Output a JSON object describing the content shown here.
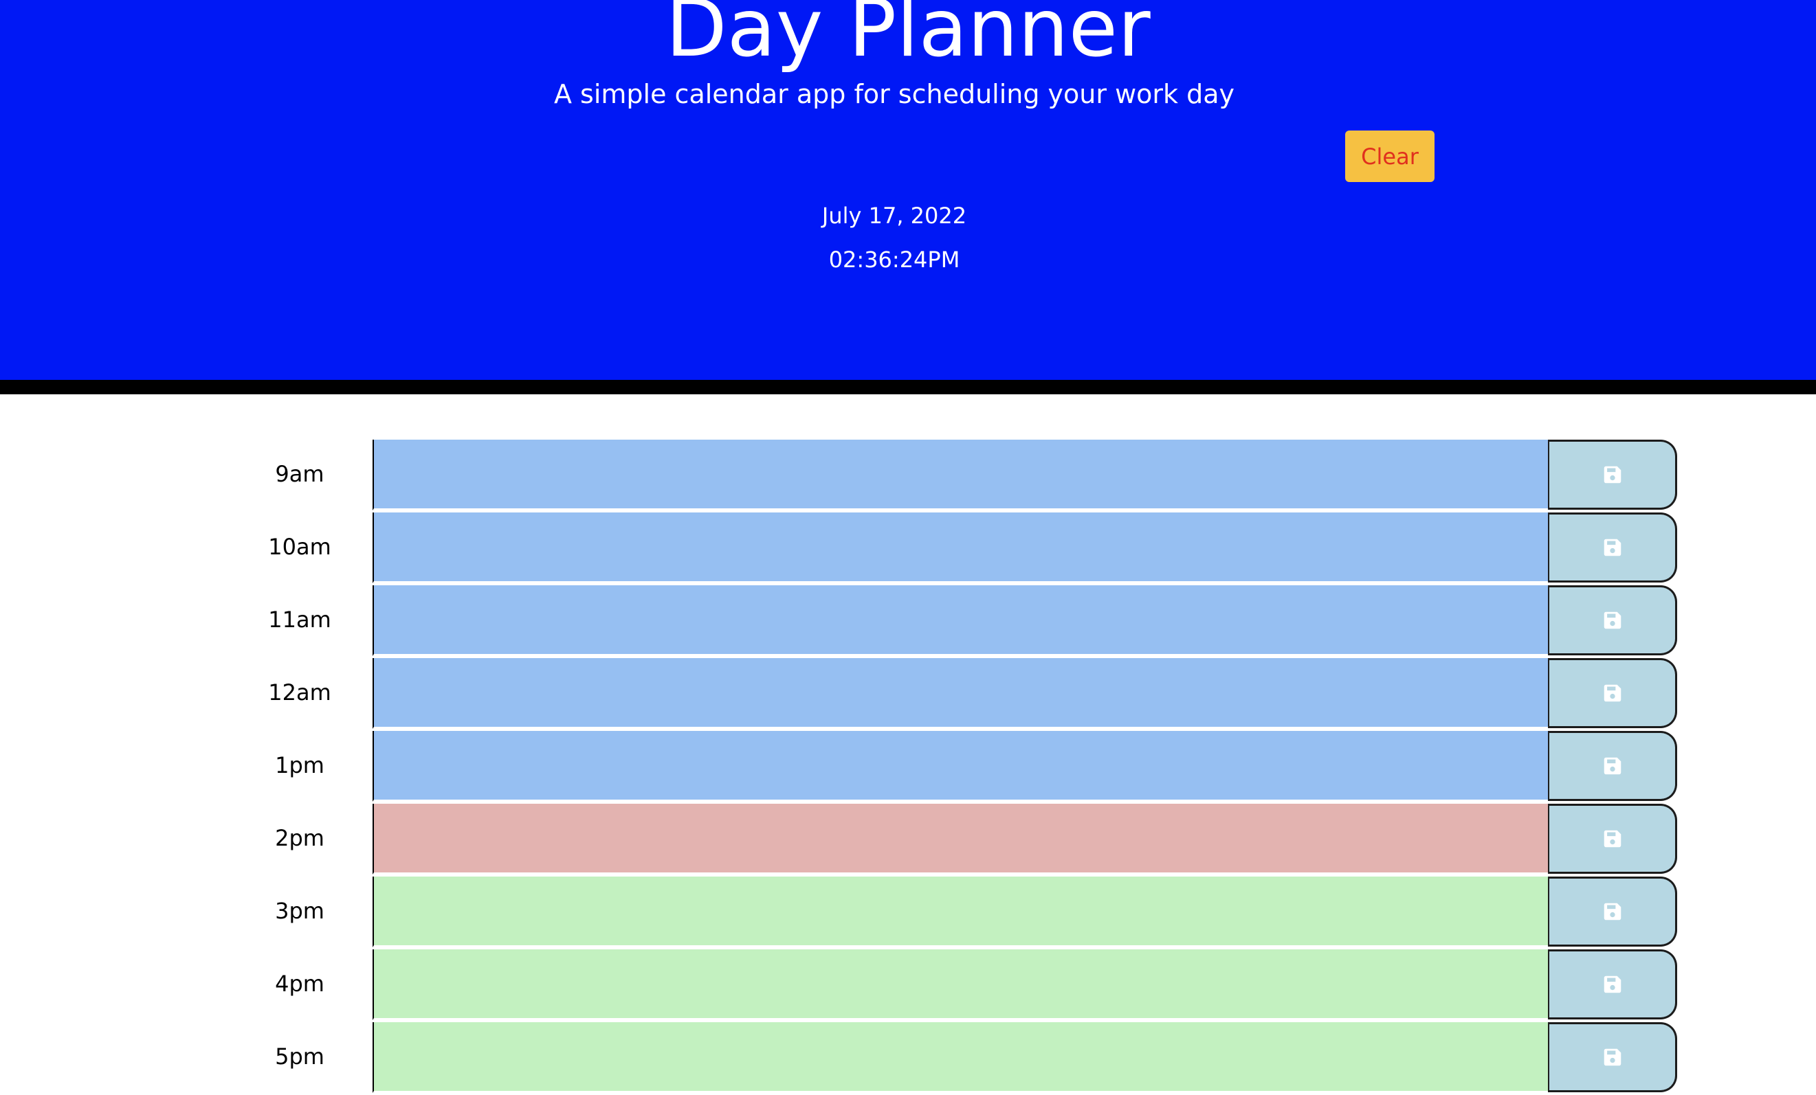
{
  "header": {
    "title": "Day Planner",
    "subtitle": "A simple calendar app for scheduling your work day",
    "clear_label": "Clear",
    "date": "July 17, 2022",
    "time": "02:36:24PM"
  },
  "colors": {
    "header_bg": "#0018f5",
    "past": "#96bff2",
    "present": "#e3b3b0",
    "future": "#c3f1c0",
    "save_bg": "#b6d7e3",
    "clear_bg": "#f6c142",
    "clear_text": "#e0301e"
  },
  "save_icon": "floppy-disk-icon",
  "hours": [
    {
      "label": "9am",
      "status": "past",
      "value": ""
    },
    {
      "label": "10am",
      "status": "past",
      "value": ""
    },
    {
      "label": "11am",
      "status": "past",
      "value": ""
    },
    {
      "label": "12am",
      "status": "past",
      "value": ""
    },
    {
      "label": "1pm",
      "status": "past",
      "value": ""
    },
    {
      "label": "2pm",
      "status": "present",
      "value": ""
    },
    {
      "label": "3pm",
      "status": "future",
      "value": ""
    },
    {
      "label": "4pm",
      "status": "future",
      "value": ""
    },
    {
      "label": "5pm",
      "status": "future",
      "value": ""
    }
  ]
}
